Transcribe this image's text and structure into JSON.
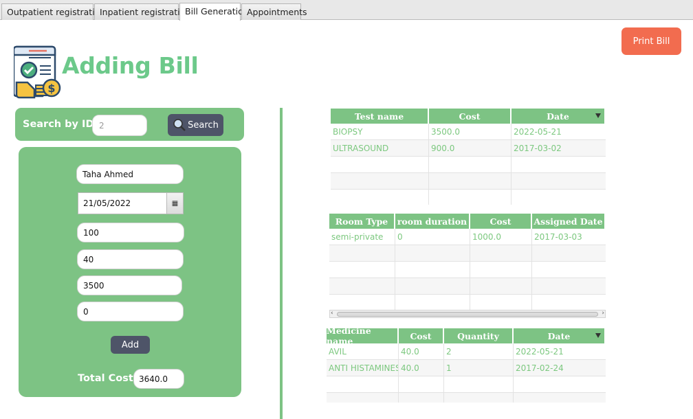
{
  "tabs": [
    {
      "label": "Outpatient registration"
    },
    {
      "label": "Inpatient registration"
    },
    {
      "label": "Bill Generation"
    },
    {
      "label": "Appointments"
    }
  ],
  "active_tab": "Bill Generation",
  "header": {
    "title": "Adding Bill",
    "print_label": "Print Bill"
  },
  "search": {
    "label": "Search by ID",
    "value": "2",
    "button_label": "Search"
  },
  "form": {
    "name": "Taha Ahmed",
    "date": "21/05/2022",
    "field1": "100",
    "field2": "40",
    "field3": "3500",
    "field4": "0",
    "add_label": "Add",
    "total_label": "Total Cost",
    "total_value": "3640.0"
  },
  "tests_table": {
    "headers": [
      "Test name",
      "Cost",
      "Date"
    ],
    "rows": [
      [
        "BIOPSY",
        "3500.0",
        "2022-05-21"
      ],
      [
        "ULTRASOUND",
        "900.0",
        "2017-03-02"
      ]
    ]
  },
  "rooms_table": {
    "headers": [
      "Room Type",
      "room duration",
      "Cost",
      "Assigned Date"
    ],
    "rows": [
      [
        "semi-private",
        "0",
        "1000.0",
        "2017-03-03"
      ]
    ]
  },
  "medicine_table": {
    "headers": [
      "Medicine name",
      "Cost",
      "Quantity",
      "Date"
    ],
    "rows": [
      [
        "AVIL",
        "40.0",
        "2",
        "2022-05-21"
      ],
      [
        "ANTI HISTAMINES",
        "40.0",
        "1",
        "2017-02-24"
      ]
    ]
  },
  "colors": {
    "accent_green": "#7dc384",
    "title_green": "#6cc98a",
    "print_button": "#f26c4f",
    "dark_button": "#4e5468"
  },
  "icons": {
    "logo": "bill-document-icon",
    "search": "magnifier-icon",
    "calendar": "calendar-icon",
    "sort": "sort-descending-icon"
  }
}
